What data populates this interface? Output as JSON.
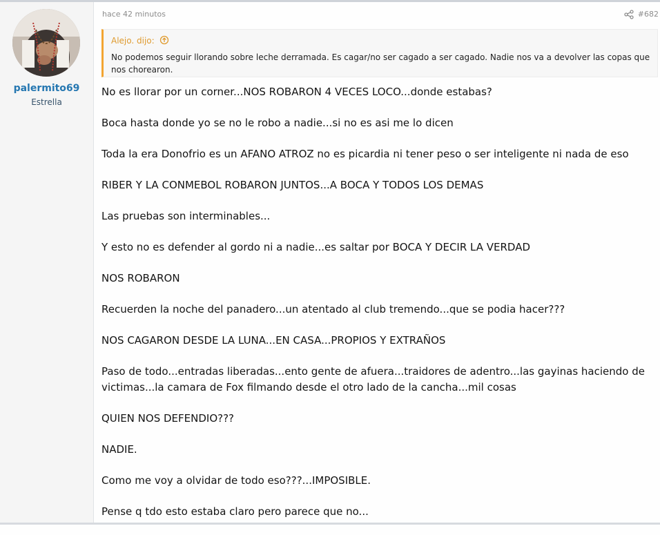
{
  "user": {
    "name": "palermito69",
    "title": "Estrella"
  },
  "post": {
    "time": "hace 42 minutos",
    "number": "#682",
    "quote": {
      "author": "Alejo. dijo:",
      "text": "No podemos seguir llorando sobre leche derramada. Es cagar/no ser cagado a ser cagado. Nadie nos va a devolver las copas que nos chorearon."
    },
    "paragraphs": [
      "No es llorar por un corner...NOS ROBARON 4 VECES LOCO...donde estabas?",
      "Boca hasta donde yo se no le robo a nadie...si no es asi me lo dicen",
      "Toda la era Donofrio es un AFANO ATROZ no es picardia ni tener peso o ser inteligente ni nada de eso",
      "RIBER Y LA CONMEBOL ROBARON JUNTOS...A BOCA Y TODOS LOS DEMAS",
      "Las pruebas son interminables...",
      "Y esto no es defender al gordo ni a nadie...es saltar por BOCA Y DECIR LA VERDAD",
      "NOS ROBARON",
      "Recuerden la noche del panadero...un atentado al club tremendo...que se podia hacer???",
      "NOS CAGARON DESDE LA LUNA...EN CASA...PROPIOS Y EXTRAÑOS",
      "Paso de todo...entradas liberadas...ento gente de afuera...traidores de adentro...las gayinas haciendo de victimas...la camara de Fox filmando desde el otro lado de la cancha...mil cosas",
      "QUIEN NOS DEFENDIO???",
      "NADIE.",
      "Como me voy a olvidar de todo eso???...IMPOSIBLE.",
      "Pense q tdo esto estaba claro pero parece que no..."
    ]
  },
  "icons": {
    "share": "share-icon",
    "quote_jump": "arrow-up-circle-icon"
  },
  "colors": {
    "username": "#2577b1",
    "quote_accent": "#f3a531",
    "quote_author": "#df9a2d",
    "user_column_bg": "#f5f5f5"
  }
}
